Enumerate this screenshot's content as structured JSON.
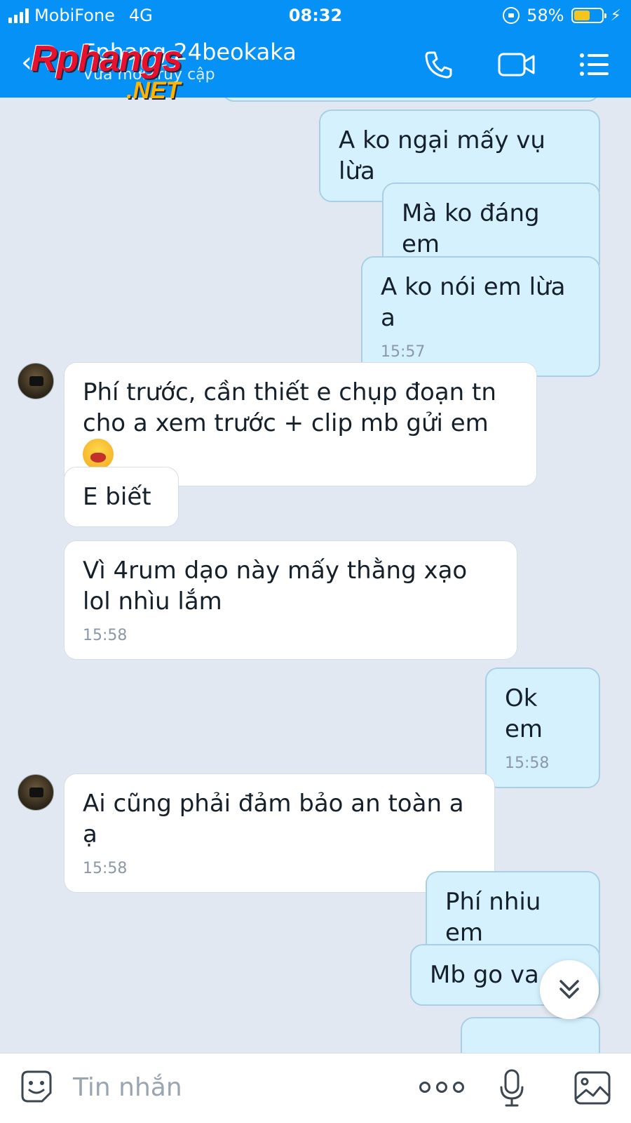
{
  "status_bar": {
    "carrier": "MobiFone",
    "network": "4G",
    "time": "08:32",
    "battery": "58%",
    "battery_level": 0.58
  },
  "header": {
    "contact_name": "Fphang 24beokaka",
    "status": "Vừa mới truy cập",
    "back_icon": "chevron-left-icon",
    "call_icon": "phone-icon",
    "video_icon": "video-camera-icon",
    "menu_icon": "list-menu-icon"
  },
  "watermark": {
    "line1": "Rphangs",
    "line2": ".NET"
  },
  "messages": [
    {
      "dir": "out",
      "text": "A ko ngại mấy vụ lừa",
      "time": ""
    },
    {
      "dir": "out",
      "text": "Mà ko đáng em",
      "time": ""
    },
    {
      "dir": "out",
      "text": "A ko nói em lừa a",
      "time": "15:57"
    },
    {
      "dir": "in",
      "text": "Phí trước, cần thiết e chụp đoạn tn cho a xem trước + clip mb gửi em",
      "time": "",
      "emoji": "laughing-face-emoji"
    },
    {
      "dir": "in",
      "text": "E biết",
      "time": ""
    },
    {
      "dir": "in",
      "text": "Vì 4rum dạo này mấy thằng xạo lol nhìu lắm",
      "time": "15:58"
    },
    {
      "dir": "out",
      "text": "Ok em",
      "time": "15:58"
    },
    {
      "dir": "in",
      "text": "Ai cũng phải đảm bảo an toàn a ạ",
      "time": "15:58"
    },
    {
      "dir": "out",
      "text": "Phí nhiu em",
      "time": ""
    },
    {
      "dir": "out",
      "text": "Mb go va",
      "time": ""
    }
  ],
  "composer": {
    "placeholder": "Tin nhắn",
    "sticker_icon": "sticker-icon",
    "more_icon": "more-dots-icon",
    "mic_icon": "microphone-icon",
    "gallery_icon": "image-gallery-icon"
  },
  "colors": {
    "header_bg": "#0591f5",
    "chat_bg": "#e2e8f1",
    "outgoing_bubble": "#d5f1fe",
    "incoming_bubble": "#ffffff"
  }
}
